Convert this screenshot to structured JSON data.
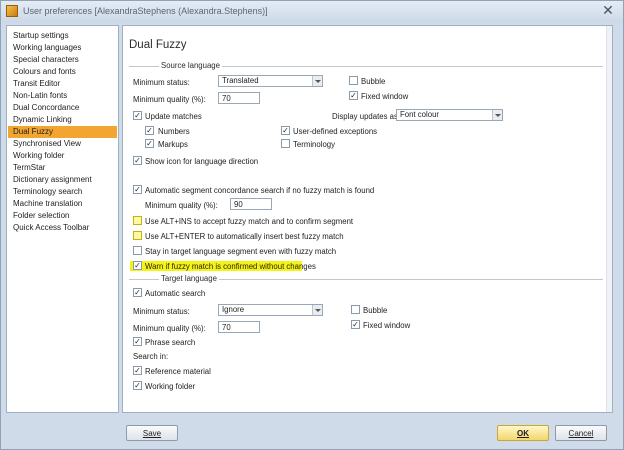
{
  "window": {
    "title": "User preferences [AlexandraStephens (Alexandra.Stephens)]",
    "close_glyph": "✕"
  },
  "nav": {
    "items": [
      {
        "label": "Startup settings",
        "selected": false
      },
      {
        "label": "Working languages",
        "selected": false
      },
      {
        "label": "Special characters",
        "selected": false
      },
      {
        "label": "Colours and fonts",
        "selected": false
      },
      {
        "label": "Transit Editor",
        "selected": false
      },
      {
        "label": "Non-Latin fonts",
        "selected": false
      },
      {
        "label": "Dual Concordance",
        "selected": false
      },
      {
        "label": "Dynamic Linking",
        "selected": false
      },
      {
        "label": "Dual Fuzzy",
        "selected": true
      },
      {
        "label": "Synchronised View",
        "selected": false
      },
      {
        "label": "Working folder",
        "selected": false
      },
      {
        "label": "TermStar",
        "selected": false
      },
      {
        "label": "Dictionary assignment",
        "selected": false
      },
      {
        "label": "Terminology search",
        "selected": false
      },
      {
        "label": "Machine translation",
        "selected": false
      },
      {
        "label": "Folder selection",
        "selected": false
      },
      {
        "label": "Quick Access Toolbar",
        "selected": false
      }
    ]
  },
  "panel": {
    "title": "Dual Fuzzy",
    "source": {
      "group_label": "Source language",
      "min_status_label": "Minimum status:",
      "min_status_value": "Translated",
      "bubble_label": "Bubble",
      "bubble_checked": false,
      "min_quality_label": "Minimum quality (%):",
      "min_quality_value": "70",
      "fixed_window_label": "Fixed window",
      "fixed_window_checked": true,
      "update_matches_label": "Update matches",
      "update_matches_checked": true,
      "display_updates_label": "Display updates as",
      "display_updates_value": "Font colour",
      "numbers_label": "Numbers",
      "numbers_checked": true,
      "user_defined_label": "User-defined exceptions",
      "user_defined_checked": true,
      "markups_label": "Markups",
      "markups_checked": true,
      "terminology_label": "Terminology",
      "terminology_checked": false,
      "show_icon_label": "Show icon for language direction",
      "show_icon_checked": true
    },
    "options": {
      "auto_concordance_label": "Automatic segment concordance search if no fuzzy match is found",
      "auto_concordance_checked": true,
      "auto_min_quality_label": "Minimum quality (%):",
      "auto_min_quality_value": "90",
      "alt_ins_label": "Use ALT+INS to accept fuzzy match and to confirm segment",
      "alt_ins_checked": false,
      "alt_enter_label": "Use ALT+ENTER to automatically insert best fuzzy match",
      "alt_enter_checked": false,
      "stay_label": "Stay in target language segment even with fuzzy match",
      "stay_checked": false,
      "warn_label": "Warn if fuzzy match is confirmed without changes",
      "warn_checked": true,
      "highlight_color": "#f5f311"
    },
    "target": {
      "group_label": "Target language",
      "auto_search_label": "Automatic search",
      "auto_search_checked": true,
      "min_status_label": "Minimum status:",
      "min_status_value": "Ignore",
      "bubble_label": "Bubble",
      "bubble_checked": false,
      "min_quality_label": "Minimum quality (%):",
      "min_quality_value": "70",
      "fixed_window_label": "Fixed window",
      "fixed_window_checked": true,
      "phrase_search_label": "Phrase search",
      "phrase_search_checked": true,
      "search_in_label": "Search in:",
      "reference_label": "Reference material",
      "reference_checked": true,
      "working_folder_label": "Working folder",
      "working_folder_checked": true
    }
  },
  "buttons": {
    "save": "Save",
    "ok": "OK",
    "cancel": "Cancel"
  },
  "colors": {
    "selected_nav": "#f2a531",
    "ok_button": "#f3d66d",
    "window_bg": "#cfdbe8"
  }
}
